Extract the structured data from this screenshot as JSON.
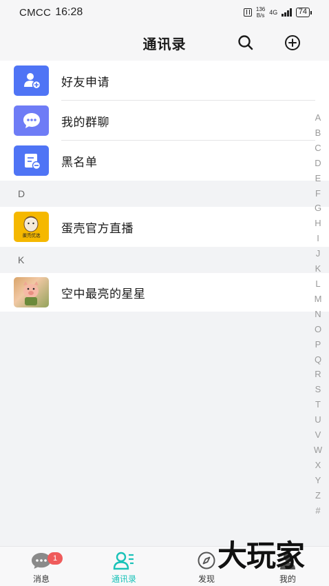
{
  "status_bar": {
    "carrier": "CMCC",
    "time": "16:28",
    "net_speed_value": "136",
    "net_speed_unit": "B/s",
    "network": "4G",
    "battery": "74"
  },
  "header": {
    "title": "通讯录"
  },
  "quick_items": [
    {
      "label": "好友申请",
      "icon": "add-user-icon"
    },
    {
      "label": "我的群聊",
      "icon": "chat-bubble-icon"
    },
    {
      "label": "黑名单",
      "icon": "blacklist-icon"
    }
  ],
  "sections": [
    {
      "letter": "D",
      "contacts": [
        {
          "name": "蛋壳官方直播",
          "avatar_text": "蛋壳优选"
        }
      ]
    },
    {
      "letter": "K",
      "contacts": [
        {
          "name": "空中最亮的星星"
        }
      ]
    }
  ],
  "alphabet_index": [
    "A",
    "B",
    "C",
    "D",
    "E",
    "F",
    "G",
    "H",
    "I",
    "J",
    "K",
    "L",
    "M",
    "N",
    "O",
    "P",
    "Q",
    "R",
    "S",
    "T",
    "U",
    "V",
    "W",
    "X",
    "Y",
    "Z",
    "#"
  ],
  "tabs": [
    {
      "label": "消息",
      "icon": "chat-icon",
      "badge": "1"
    },
    {
      "label": "通讯录",
      "icon": "contacts-icon",
      "active": true
    },
    {
      "label": "发现",
      "icon": "compass-icon"
    },
    {
      "label": "我的",
      "icon": "profile-icon"
    }
  ],
  "watermark": "大玩家",
  "colors": {
    "accent": "#19c2b8",
    "icon_blue": "#4f74f5",
    "badge": "#ef5b5b"
  }
}
